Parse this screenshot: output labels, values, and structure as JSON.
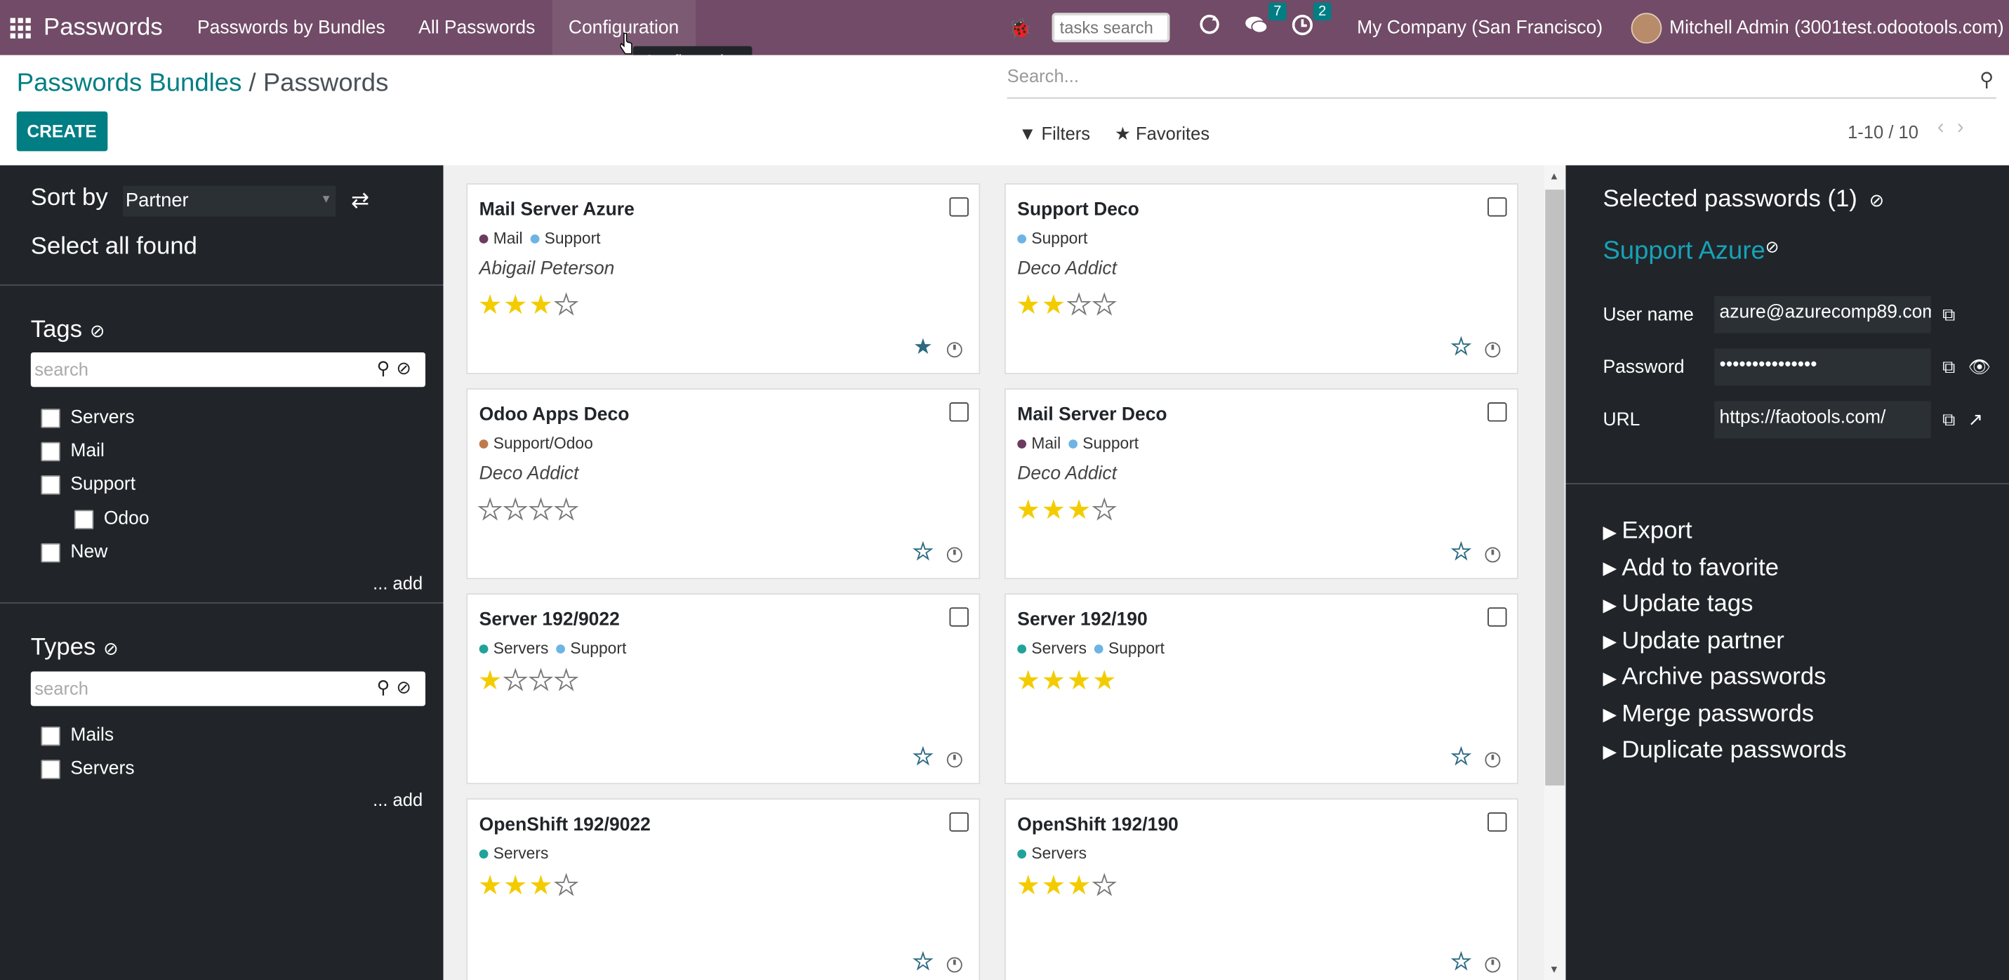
{
  "topbar": {
    "brand": "Passwords",
    "menu": [
      "Passwords by Bundles",
      "All Passwords",
      "Configuration"
    ],
    "tasks_placeholder": "tasks search",
    "messages_count": "7",
    "activities_count": "2",
    "company": "My Company (San Francisco)",
    "user": "Mitchell Admin (3001test.odootools.com)",
    "tooltip": "Configuration"
  },
  "control": {
    "breadcrumb_parent": "Passwords Bundles",
    "breadcrumb_sep": "/",
    "breadcrumb_current": "Passwords",
    "create_label": "CREATE",
    "search_placeholder": "Search...",
    "filters_label": "Filters",
    "favorites_label": "Favorites",
    "pager": "1-10 / 10"
  },
  "left": {
    "sort_label": "Sort by",
    "sort_value": "Partner",
    "select_all": "Select all found",
    "tags_title": "Tags",
    "tags_search_placeholder": "search",
    "tags": [
      "Servers",
      "Mail",
      "Support",
      "Odoo",
      "New"
    ],
    "add_label": "... add",
    "types_title": "Types",
    "types_search_placeholder": "search",
    "types": [
      "Mails",
      "Servers"
    ]
  },
  "cards": [
    {
      "name": "Mail Server Azure",
      "tags": [
        {
          "label": "Mail",
          "color": "#6b3c5f"
        },
        {
          "label": "Support",
          "color": "#6cb4e4"
        }
      ],
      "partner": "Abigail Peterson",
      "rating": 3,
      "favorite": true
    },
    {
      "name": "Support Deco",
      "tags": [
        {
          "label": "Support",
          "color": "#6cb4e4"
        }
      ],
      "partner": "Deco Addict",
      "rating": 2,
      "favorite": false
    },
    {
      "name": "Odoo Apps Deco",
      "tags": [
        {
          "label": "Support/Odoo",
          "color": "#c07a4a"
        }
      ],
      "partner": "Deco Addict",
      "rating": 0,
      "favorite": false
    },
    {
      "name": "Mail Server Deco",
      "tags": [
        {
          "label": "Mail",
          "color": "#6b3c5f"
        },
        {
          "label": "Support",
          "color": "#6cb4e4"
        }
      ],
      "partner": "Deco Addict",
      "rating": 3,
      "favorite": false
    },
    {
      "name": "Server 192/9022",
      "tags": [
        {
          "label": "Servers",
          "color": "#21a29a"
        },
        {
          "label": "Support",
          "color": "#6cb4e4"
        }
      ],
      "partner": "",
      "rating": 1,
      "favorite": false
    },
    {
      "name": "Server 192/190",
      "tags": [
        {
          "label": "Servers",
          "color": "#21a29a"
        },
        {
          "label": "Support",
          "color": "#6cb4e4"
        }
      ],
      "partner": "",
      "rating": 4,
      "favorite": false
    },
    {
      "name": "OpenShift 192/9022",
      "tags": [
        {
          "label": "Servers",
          "color": "#21a29a"
        }
      ],
      "partner": "",
      "rating": 3,
      "favorite": false
    },
    {
      "name": "OpenShift 192/190",
      "tags": [
        {
          "label": "Servers",
          "color": "#21a29a"
        }
      ],
      "partner": "",
      "rating": 3,
      "favorite": false
    }
  ],
  "right": {
    "selected_title": "Selected passwords (1)",
    "record_name": "Support Azure",
    "user_label": "User name",
    "user_value": "azure@azurecomp89.com",
    "password_label": "Password",
    "password_value": "•••••••••••••••",
    "url_label": "URL",
    "url_value": "https://faotools.com/",
    "actions": [
      "Export",
      "Add to favorite",
      "Update tags",
      "Update partner",
      "Archive passwords",
      "Merge passwords",
      "Duplicate passwords"
    ]
  },
  "colors": {
    "topbar": "#714b67",
    "accent": "#017e84",
    "panel": "#212529",
    "star": "#f3cc00"
  }
}
